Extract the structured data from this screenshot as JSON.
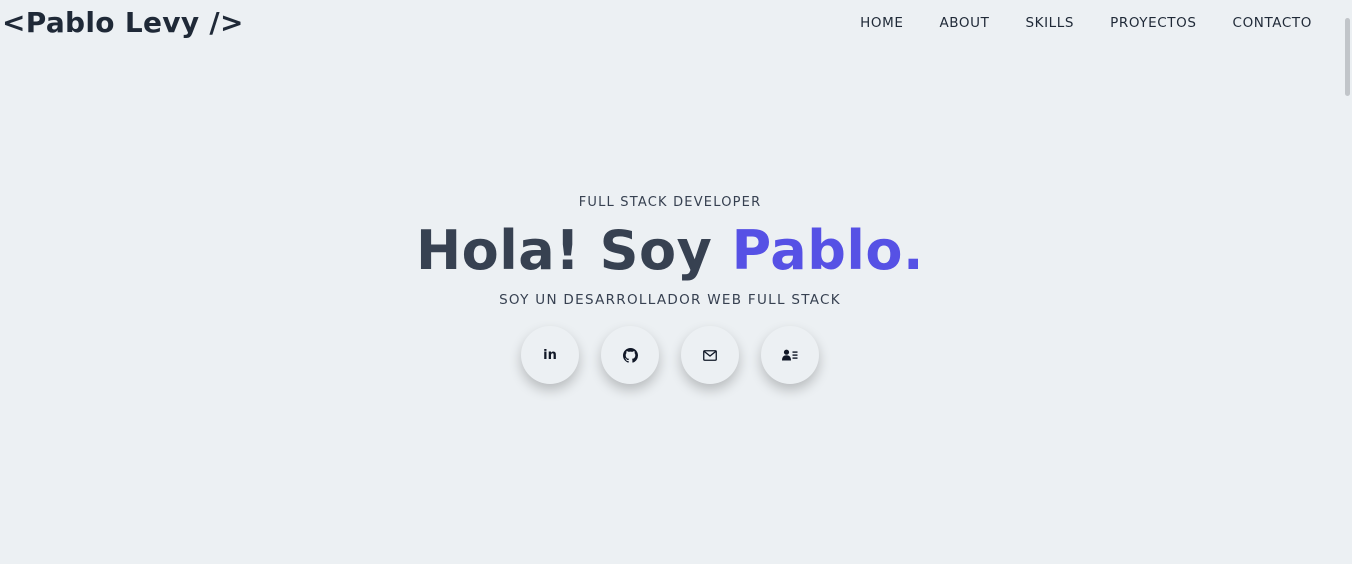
{
  "header": {
    "logo": "<Pablo Levy />",
    "nav": [
      {
        "label": "HOME"
      },
      {
        "label": "ABOUT"
      },
      {
        "label": "SKILLS"
      },
      {
        "label": "PROYECTOS"
      },
      {
        "label": "CONTACTO"
      }
    ]
  },
  "hero": {
    "subtitle": "FULL STACK DEVELOPER",
    "headline_prefix": "Hola! Soy ",
    "headline_name": "Pablo.",
    "tagline": "SOY UN DESARROLLADOR WEB FULL STACK",
    "socials": [
      {
        "icon": "linkedin-icon",
        "text": "in"
      },
      {
        "icon": "github-icon"
      },
      {
        "icon": "mail-icon"
      },
      {
        "icon": "resume-icon"
      }
    ]
  },
  "colors": {
    "background": "#ecf0f3",
    "text": "#374151",
    "accent": "#5651e5"
  }
}
